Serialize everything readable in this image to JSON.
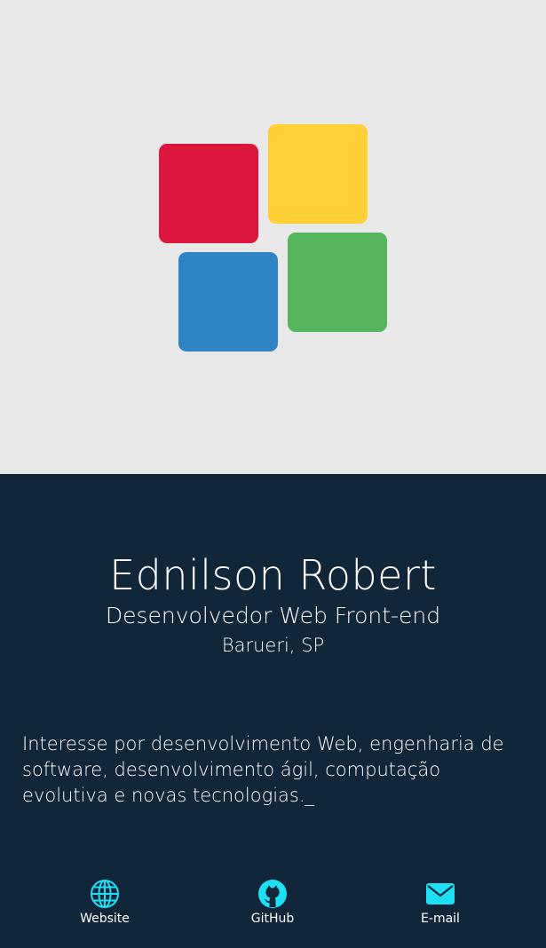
{
  "logo": {
    "colors": {
      "red": "#dc163c",
      "yellow": "#ffd137",
      "blue": "#2f84c5",
      "green": "#55b65d"
    }
  },
  "profile": {
    "name": "Ednilson Robert",
    "role": "Desenvolvedor Web Front-end",
    "location": "Barueri, SP",
    "bio": "Interesse por desenvolvimento Web, engenharia de software, desenvolvimento ágil, computação evolutiva e novas tecnologias._"
  },
  "links": [
    {
      "label": "Website",
      "icon": "globe-icon"
    },
    {
      "label": "GitHub",
      "icon": "github-icon"
    },
    {
      "label": "E-mail",
      "icon": "envelope-icon"
    }
  ],
  "theme": {
    "hero_bg": "#e8e8e8",
    "panel_bg": "#12263a",
    "icon_color": "#1ee0f5",
    "text_color": "#ffffff"
  }
}
